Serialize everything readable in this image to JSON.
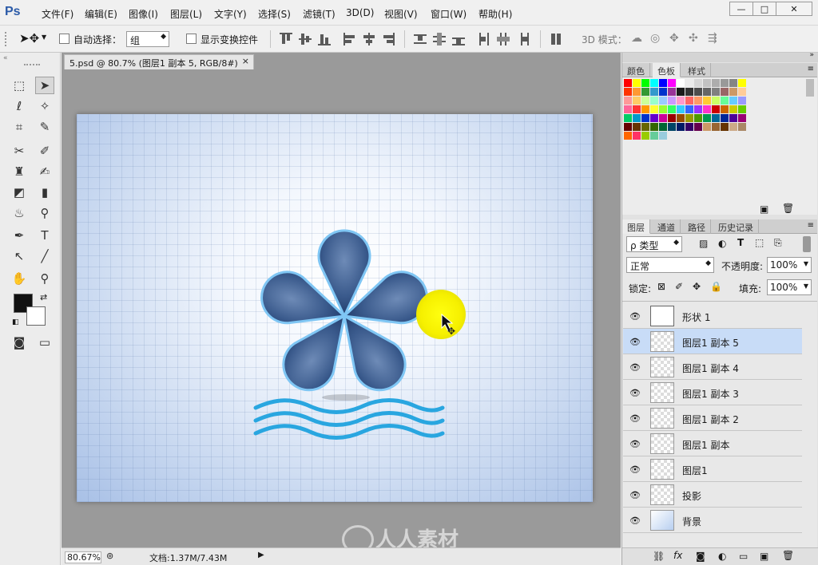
{
  "app": {
    "logo": "Ps"
  },
  "menubar": {
    "items": [
      "文件(F)",
      "编辑(E)",
      "图像(I)",
      "图层(L)",
      "文字(Y)",
      "选择(S)",
      "滤镜(T)",
      "3D(D)",
      "视图(V)",
      "窗口(W)",
      "帮助(H)"
    ]
  },
  "window_controls": {
    "minimize": "—",
    "maximize": "□",
    "close": "✕"
  },
  "options": {
    "auto_select_label": "自动选择：",
    "auto_select_value": "组",
    "show_transform_label": "显示变换控件",
    "mode_3d_label": "3D 模式："
  },
  "document": {
    "tab_title": "5.psd @ 80.7% (图层1 副本 5, RGB/8#)",
    "tab_close": "×",
    "zoom": "80.67%",
    "doc_size": "文档:1.37M/7.43M"
  },
  "panels": {
    "top_tabs": [
      "颜色",
      "色板",
      "样式"
    ],
    "top_active": 1,
    "layer_tabs": [
      "图层",
      "通道",
      "路径",
      "历史记录"
    ],
    "layer_active": 0,
    "filter_label": "ρ 类型",
    "blend_mode": "正常",
    "opacity_label": "不透明度:",
    "opacity_value": "100%",
    "lock_label": "锁定:",
    "fill_label": "填充:",
    "fill_value": "100%"
  },
  "swatch_colors": [
    "#ff0000",
    "#ffff00",
    "#00ff00",
    "#00ffff",
    "#0000ff",
    "#ff00ff",
    "#ffffff",
    "#ebebeb",
    "#d6d6d6",
    "#c2c2c2",
    "#adadad",
    "#999999",
    "#858585",
    "#ffff00",
    "#ff3300",
    "#ff9933",
    "#339933",
    "#3399cc",
    "#0033cc",
    "#993399",
    "#1a1a1a",
    "#333333",
    "#4d4d4d",
    "#666666",
    "#808080",
    "#996666",
    "#cc9966",
    "#ffcc99",
    "#ff9999",
    "#ffcc66",
    "#ccff99",
    "#99ffcc",
    "#99ccff",
    "#cc99ff",
    "#ff99cc",
    "#ff6666",
    "#ff9966",
    "#ffcc33",
    "#ccff66",
    "#66ff99",
    "#66ccff",
    "#9999ff",
    "#ff6699",
    "#ff3333",
    "#ff9900",
    "#ffff33",
    "#99ff33",
    "#33ff66",
    "#33ccff",
    "#3366ff",
    "#9933ff",
    "#ff33cc",
    "#cc0000",
    "#cc6600",
    "#cccc00",
    "#66cc00",
    "#00cc66",
    "#0099cc",
    "#0033cc",
    "#6600cc",
    "#cc0099",
    "#990000",
    "#994c00",
    "#999900",
    "#4d9900",
    "#00994d",
    "#006699",
    "#002699",
    "#4c0099",
    "#990073",
    "#660000",
    "#663300",
    "#666600",
    "#336600",
    "#006633",
    "#004466",
    "#001a66",
    "#330066",
    "#66004d",
    "#cc9966",
    "#996633",
    "#663300",
    "#ccaa88",
    "#aa8866",
    "#ff6600",
    "#ff3366",
    "#99cc00",
    "#66cc99",
    "#99ccdd"
  ],
  "layers": [
    {
      "name": "形状 1",
      "active": false
    },
    {
      "name": "图层1 副本 5",
      "active": true
    },
    {
      "name": "图层1 副本 4",
      "active": false
    },
    {
      "name": "图层1 副本 3",
      "active": false
    },
    {
      "name": "图层1 副本 2",
      "active": false
    },
    {
      "name": "图层1 副本",
      "active": false
    },
    {
      "name": "图层1",
      "active": false
    },
    {
      "name": "投影",
      "active": false
    },
    {
      "name": "背景",
      "active": false
    }
  ],
  "watermark": "人人素材",
  "icons": [
    "move-icon",
    "marquee-icon",
    "lasso-icon",
    "magic-wand-icon",
    "crop-icon",
    "eyedropper-icon",
    "healing-icon",
    "brush-icon",
    "stamp-icon",
    "history-brush-icon",
    "eraser-icon",
    "gradient-icon",
    "blur-icon",
    "dodge-icon",
    "pen-icon",
    "type-icon",
    "path-select-icon",
    "line-icon",
    "hand-icon",
    "zoom-icon",
    "eye-icon",
    "trash-icon",
    "new-layer-icon",
    "folder-icon",
    "fx-icon",
    "link-icon"
  ],
  "colors": {
    "accent_selection": "#c8dcf7",
    "flower_fill": "#2f4f7e",
    "wave": "#29a6e0",
    "cursor_highlight": "#ffff00"
  }
}
